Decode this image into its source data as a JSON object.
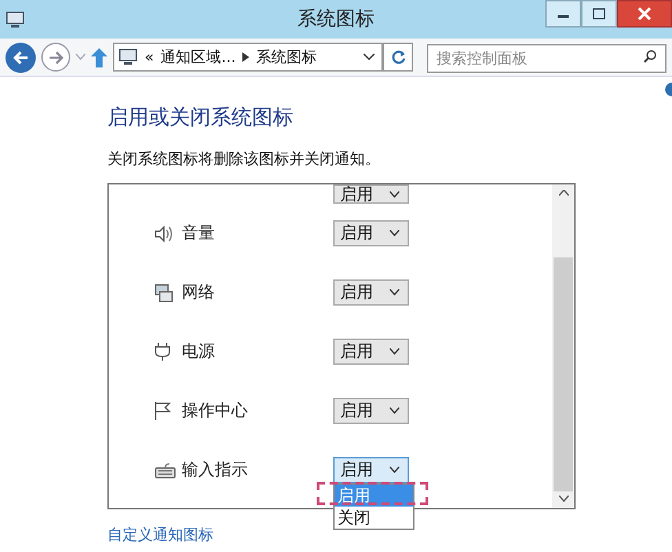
{
  "window": {
    "title": "系统图标"
  },
  "address_bar": {
    "overflow": "«",
    "crumbs": [
      "通知区域...",
      "系统图标"
    ]
  },
  "search": {
    "placeholder": "搜索控制面板"
  },
  "heading": "启用或关闭系统图标",
  "description": "关闭系统图标将删除该图标并关闭通知。",
  "top_cut_select": {
    "value": "启用"
  },
  "rows": [
    {
      "label": "音量",
      "value": "启用",
      "open": false
    },
    {
      "label": "网络",
      "value": "启用",
      "open": false
    },
    {
      "label": "电源",
      "value": "启用",
      "open": false
    },
    {
      "label": "操作中心",
      "value": "启用",
      "open": false
    },
    {
      "label": "输入指示",
      "value": "启用",
      "open": true,
      "options": [
        {
          "label": "启用",
          "selected": true
        },
        {
          "label": "关闭",
          "selected": false
        }
      ]
    }
  ],
  "link": "自定义通知图标"
}
